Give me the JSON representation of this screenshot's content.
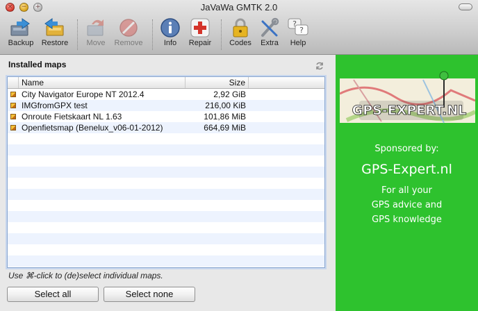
{
  "window": {
    "title": "JaVaWa GMTK 2.0"
  },
  "toolbar": {
    "backup": "Backup",
    "restore": "Restore",
    "move": "Move",
    "remove": "Remove",
    "info": "Info",
    "repair": "Repair",
    "codes": "Codes",
    "extra": "Extra",
    "help": "Help"
  },
  "panel": {
    "title": "Installed maps",
    "columns": {
      "name": "Name",
      "size": "Size"
    },
    "maps": [
      {
        "name": "City Navigator Europe NT 2012.4",
        "size": "2,92 GiB"
      },
      {
        "name": "IMGfromGPX test",
        "size": "216,00 KiB"
      },
      {
        "name": "Onroute Fietskaart NL 1.63",
        "size": "101,86 MiB"
      },
      {
        "name": "Openfietsmap (Benelux_v06-01-2012)",
        "size": "664,69 MiB"
      }
    ],
    "hint": "Use ⌘-click to (de)select individual maps.",
    "select_all": "Select all",
    "select_none": "Select none"
  },
  "sponsor": {
    "logo_text": "GPS-EXPERT.NL",
    "sponsored_by": "Sponsored by:",
    "name": "GPS-Expert.nl",
    "line1": "For all your",
    "line2": "GPS advice and",
    "line3": "GPS knowledge"
  },
  "colors": {
    "sponsor_bg": "#2ec22e",
    "selection_border": "#8ba7cf",
    "row_alt": "#edf3fe"
  }
}
